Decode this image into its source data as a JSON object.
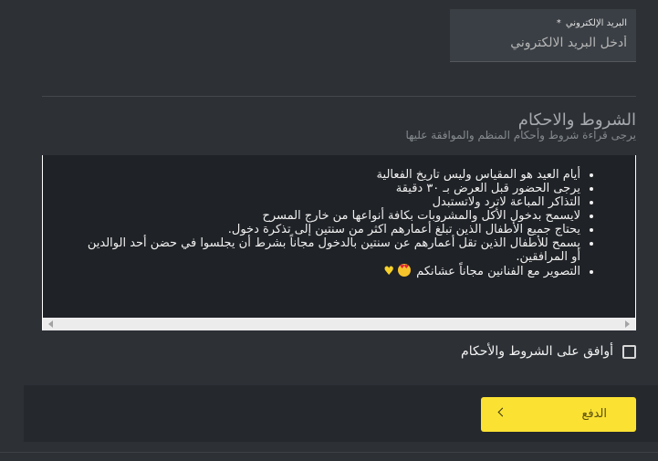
{
  "email": {
    "label": "البريد الإلكتروني",
    "required_mark": "*",
    "placeholder": "أدخل البريد الالكتروني",
    "value": ""
  },
  "terms": {
    "title": "الشروط والاحكام",
    "subtitle": "يرجى قراءة شروط وأحكام المنظم والموافقة عليها",
    "items": [
      "أيام العيد هو المقياس وليس تاريخ الفعالية",
      "يرجى الحضور قبل العرض بـ ٣٠ دقيقة",
      "التذاكر المباعة لاترد ولاتستبدل",
      "لايسمح بدخول الأكل والمشروبات بكافة أنواعها من خارج المسرح",
      "يحتاج جميع الأطفال الذين تبلغ أعمارهم اكثر من سنتين إلى تذكرة دخول.",
      "يسمح للأطفال الذين تقل أعمارهم عن سنتين بالدخول مجاناً بشرط أن يجلسوا في حضن أحد الوالدين أو المرافقين.",
      "التصوير مع الفنانين مجاناً عشانكم"
    ],
    "emojis": [
      "heart-eyes-emoji",
      "yellow-heart-emoji"
    ]
  },
  "agree": {
    "label": "أوافق على الشروط والأحكام",
    "checked": false
  },
  "pay_button": {
    "label": "الدفع"
  },
  "colors": {
    "background": "#2d3136",
    "accent": "#fbe232",
    "terms_box": "#1f2226"
  }
}
